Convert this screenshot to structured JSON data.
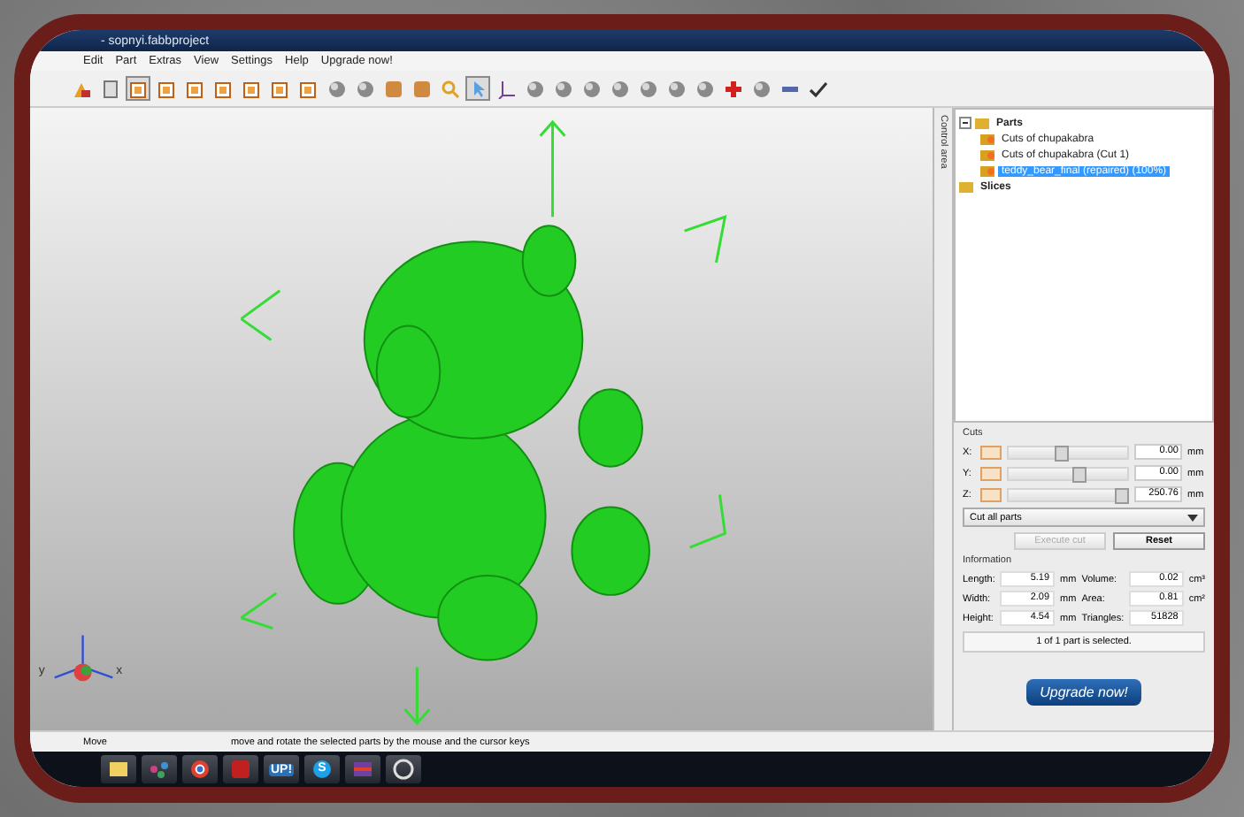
{
  "window": {
    "title": "- sopnyi.fabbproject"
  },
  "menu": [
    "Edit",
    "Part",
    "Extras",
    "View",
    "Settings",
    "Help",
    "Upgrade now!"
  ],
  "toolbar": [
    {
      "kind": "shapes",
      "selected": false
    },
    {
      "kind": "page",
      "selected": false
    },
    {
      "kind": "view",
      "selected": true
    },
    {
      "kind": "view",
      "selected": false
    },
    {
      "kind": "view",
      "selected": false
    },
    {
      "kind": "view",
      "selected": false
    },
    {
      "kind": "view",
      "selected": false
    },
    {
      "kind": "view",
      "selected": false
    },
    {
      "kind": "view",
      "selected": false
    },
    {
      "kind": "sphere",
      "selected": false
    },
    {
      "kind": "sphere",
      "selected": false
    },
    {
      "kind": "box",
      "selected": false
    },
    {
      "kind": "box",
      "selected": false
    },
    {
      "kind": "zoom",
      "selected": false
    },
    {
      "kind": "pointer",
      "selected": true
    },
    {
      "kind": "axis",
      "selected": false
    },
    {
      "kind": "sphere",
      "selected": false
    },
    {
      "kind": "sphere",
      "selected": false
    },
    {
      "kind": "sphere",
      "selected": false
    },
    {
      "kind": "sphere",
      "selected": false
    },
    {
      "kind": "sphere",
      "selected": false
    },
    {
      "kind": "sphere",
      "selected": false
    },
    {
      "kind": "sphere",
      "selected": false
    },
    {
      "kind": "plus",
      "selected": false
    },
    {
      "kind": "sphere",
      "selected": false
    },
    {
      "kind": "minus",
      "selected": false
    },
    {
      "kind": "check",
      "selected": false
    }
  ],
  "viewport": {
    "axes": [
      "y",
      "x"
    ]
  },
  "side_tab": "Control area",
  "tree": [
    {
      "label": "Parts",
      "expanded": true,
      "selected": false,
      "children": [
        {
          "label": "Cuts of chupakabra",
          "selected": false
        },
        {
          "label": "Cuts of chupakabra (Cut 1)",
          "selected": false
        },
        {
          "label": "teddy_bear_final (repaired) (100%)",
          "selected": true
        }
      ]
    },
    {
      "label": "Slices",
      "selected": false
    }
  ],
  "cuts": {
    "title": "Cuts",
    "sliders": [
      {
        "axis": "X:",
        "level": 0.45,
        "value": "0.00",
        "unit": "mm"
      },
      {
        "axis": "Y:",
        "level": 0.6,
        "value": "0.00",
        "unit": "mm"
      },
      {
        "axis": "Z:",
        "level": 0.95,
        "value": "250.76",
        "unit": "mm"
      }
    ],
    "mode": "Cut all parts",
    "buttons": [
      {
        "label": "Execute cut",
        "disabled": true
      },
      {
        "label": "Reset",
        "disabled": false
      }
    ]
  },
  "information": {
    "title": "Information",
    "fields": [
      {
        "label": "Length:",
        "value": "5.19",
        "unit": "mm"
      },
      {
        "label": "Volume:",
        "value": "0.02",
        "unit": "cm³"
      },
      {
        "label": "Width:",
        "value": "2.09",
        "unit": "mm"
      },
      {
        "label": "Area:",
        "value": "0.81",
        "unit": "cm²"
      },
      {
        "label": "Height:",
        "value": "4.54",
        "unit": "mm"
      },
      {
        "label": "Triangles:",
        "value": "51828"
      }
    ],
    "selection": "1 of 1 part is selected."
  },
  "upgrade_button": "Upgrade now!",
  "status_bar": [
    "Move",
    "move and rotate the selected parts by the mouse and the cursor keys"
  ],
  "taskbar": [
    {
      "kind": "notes"
    },
    {
      "kind": "network"
    },
    {
      "kind": "browser"
    },
    {
      "kind": "red"
    },
    {
      "kind": "up",
      "label": "UP!"
    },
    {
      "kind": "skype",
      "label": "S"
    },
    {
      "kind": "flag"
    },
    {
      "kind": "app"
    }
  ]
}
